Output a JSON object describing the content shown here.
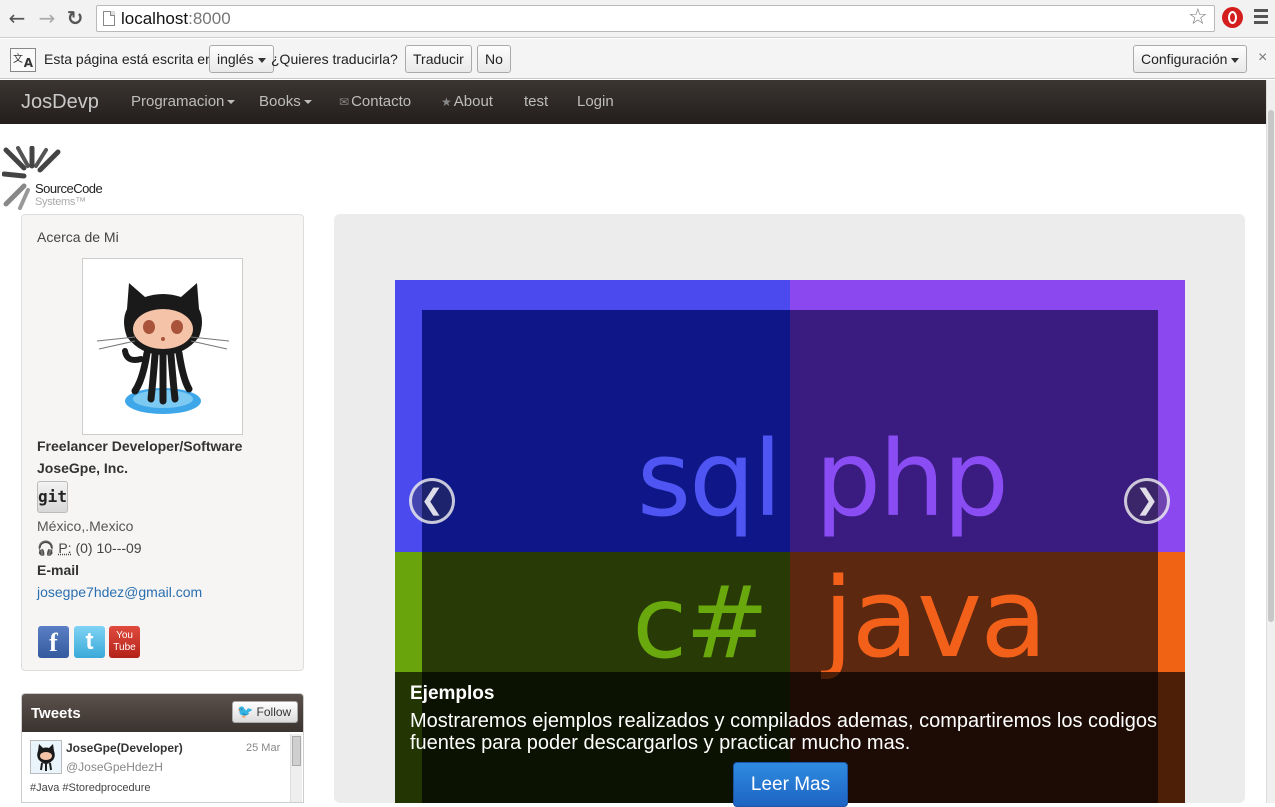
{
  "browser": {
    "url_host": "localhost",
    "url_port": ":8000",
    "icons": {
      "back": "back-arrow-icon",
      "forward": "forward-arrow-icon",
      "reload": "reload-icon",
      "star": "bookmark-star-icon",
      "menu": "menu-icon"
    }
  },
  "translate": {
    "prefix": "Esta página está escrita en",
    "language": "inglés",
    "question": "¿Quieres traducirla?",
    "translate_btn": "Traducir",
    "no_btn": "No",
    "config_btn": "Configuración",
    "close": "×"
  },
  "navbar": {
    "brand": "JosDevp",
    "items": [
      {
        "label": "Programacion"
      },
      {
        "label": "Books"
      },
      {
        "label": "Contacto"
      },
      {
        "label": "About"
      },
      {
        "label": "test"
      },
      {
        "label": "Login"
      }
    ]
  },
  "logo": {
    "line1": "SourceCode",
    "line2": "Systems™"
  },
  "profile": {
    "title": "Acerca de Mi",
    "role": "Freelancer Developer/Software",
    "company": "JoseGpe, Inc.",
    "git": "git",
    "location": "México,.Mexico",
    "phone_label": "P:",
    "phone": "(0) 10---09",
    "email_label": "E-mail",
    "email": "josegpe7hdez@gmail.com",
    "social": {
      "facebook": "f",
      "youtube_top": "You",
      "youtube_bottom": "Tube"
    }
  },
  "tweets": {
    "title": "Tweets",
    "follow": "Follow",
    "items": [
      {
        "name": "JoseGpe(Developer)",
        "handle": "@JoseGpeHdezH",
        "date": "25 Mar",
        "text": "#Java #Storedprocedure"
      }
    ]
  },
  "carousel": {
    "words": {
      "sql": "sql",
      "php": "php",
      "cs": "c#",
      "java": "java"
    },
    "caption_title": "Ejemplos",
    "caption_text": "Mostraremos ejemplos realizados y compilados ademas, compartiremos los codigos fuentes para poder descargarlos y practicar mucho mas.",
    "button": "Leer Mas",
    "prev": "❮",
    "next": "❯",
    "colors": {
      "sql": "#4a4aee",
      "php": "#8a48ee",
      "cs": "#6aa40c",
      "java": "#f06214"
    }
  }
}
